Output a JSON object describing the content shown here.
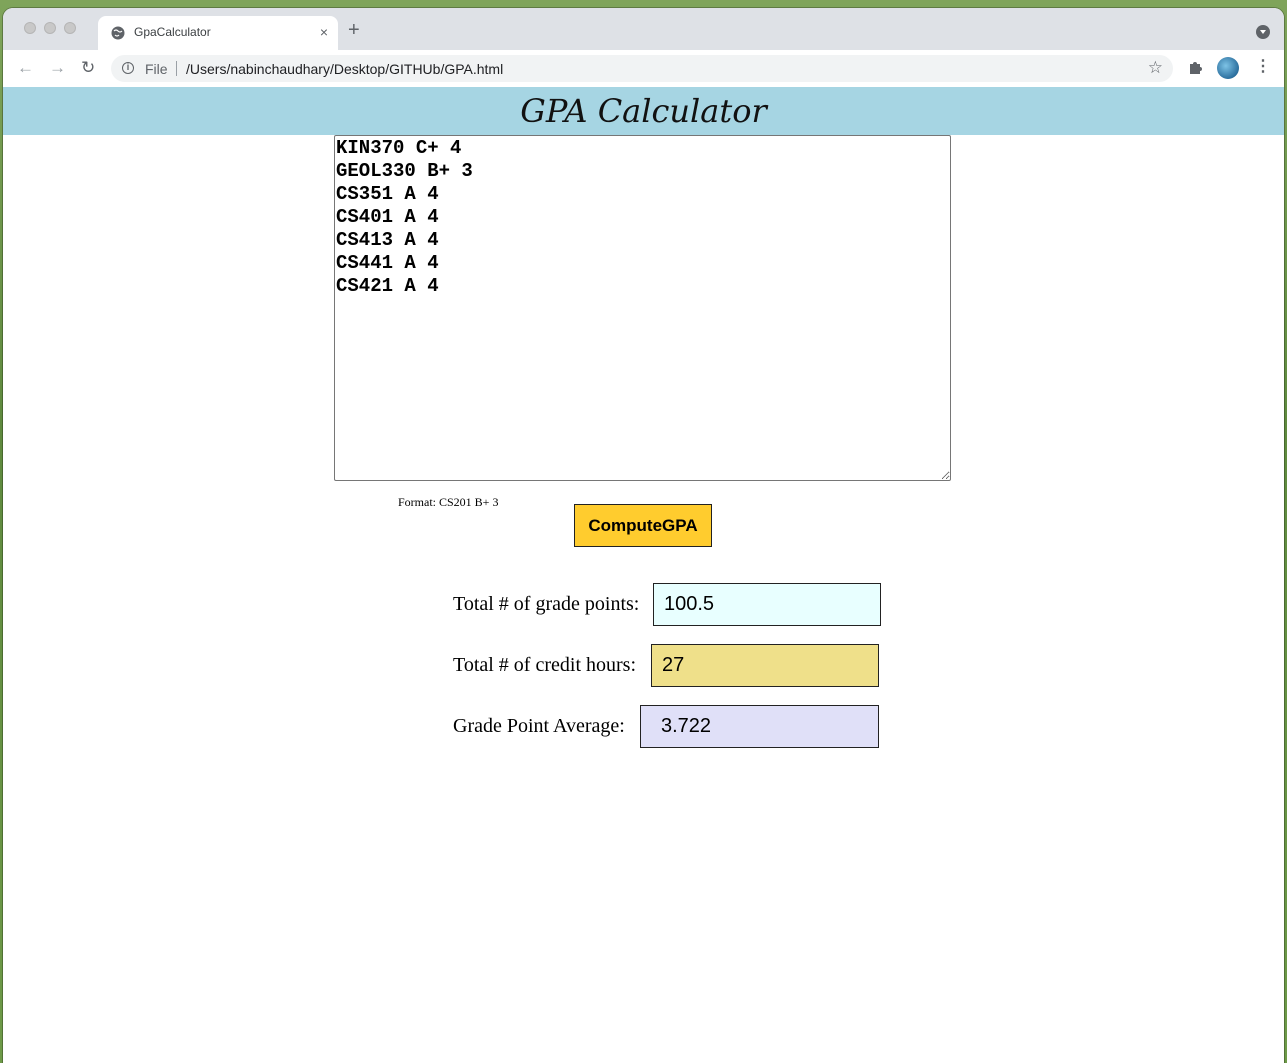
{
  "browser": {
    "tab_title": "GpaCalculator",
    "tab_close": "×",
    "new_tab": "+",
    "scheme_label": "File",
    "url": "/Users/nabinchaudhary/Desktop/GITHUb/GPA.html",
    "back": "←",
    "forward": "→",
    "reload": "↻",
    "star": "☆",
    "kebab": "⋮",
    "info": "i"
  },
  "page": {
    "title": "GPA Calculator",
    "courses_text": "KIN370 C+ 4\nGEOL330 B+ 3\nCS351 A 4\nCS401 A 4\nCS413 A 4\nCS441 A 4\nCS421 A 4",
    "format_hint": "Format: CS201 B+ 3",
    "compute_label": "ComputeGPA",
    "results": {
      "grade_points_label": "Total # of grade points:",
      "grade_points_value": "100.5",
      "credit_hours_label": "Total # of credit hours:",
      "credit_hours_value": "27",
      "gpa_label": "Grade Point Average:",
      "gpa_value": "3.722"
    }
  },
  "colors": {
    "header_bg": "#a6d5e3",
    "button_bg": "#ffcc2e",
    "grade_points_bg": "#e8ffff",
    "credit_hours_bg": "#efe08a",
    "gpa_bg": "#e0e0f8"
  },
  "icons": {
    "tab_favicon": "globe-icon",
    "extensions": "puzzle-icon",
    "profile": "avatar"
  }
}
